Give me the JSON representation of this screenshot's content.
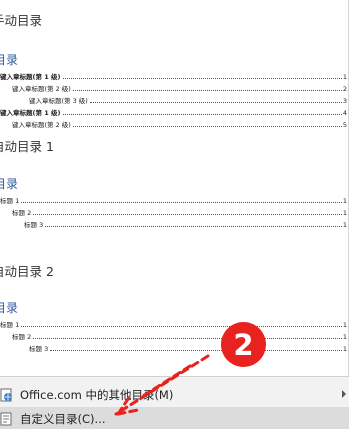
{
  "gallery": {
    "auto_toc_header": "手动目录",
    "manual_toc": {
      "title": "目录",
      "lines": [
        {
          "text": "键入章标题(第 1 级)",
          "bold": true,
          "indent": 0,
          "page": "1"
        },
        {
          "text": "键入章标题(第 2 级)",
          "bold": false,
          "indent": 1,
          "page": "2"
        },
        {
          "text": "键入章标题(第 3 级)",
          "bold": false,
          "indent": 2,
          "page": "3"
        },
        {
          "text": "键入章标题(第 1 级)",
          "bold": true,
          "indent": 0,
          "page": "4"
        },
        {
          "text": "键入章标题(第 2 级)",
          "bold": false,
          "indent": 1,
          "page": "5"
        }
      ]
    },
    "auto1_header": "自动目录 1",
    "auto1": {
      "title": "目录",
      "lines": [
        {
          "text": "标题 1",
          "indent": 0,
          "page": "1"
        },
        {
          "text": "标题 2",
          "indent": 1,
          "page": "1"
        },
        {
          "text": "标题 3",
          "indent": 2,
          "page": "1"
        }
      ]
    },
    "auto2_header": "自动目录 2",
    "auto2": {
      "title": "目录",
      "lines": [
        {
          "text": "标题 1",
          "indent": 0,
          "page": "1"
        },
        {
          "text": "标题 2",
          "indent": 1,
          "page": "1"
        },
        {
          "text": "标题 3",
          "indent": 2,
          "page": "1"
        }
      ]
    }
  },
  "menu": {
    "office_more": "Office.com 中的其他目录(M)",
    "custom_toc": "自定义目录(C)..."
  },
  "annotation": {
    "step_number": "2",
    "accent": "#e8231f"
  }
}
